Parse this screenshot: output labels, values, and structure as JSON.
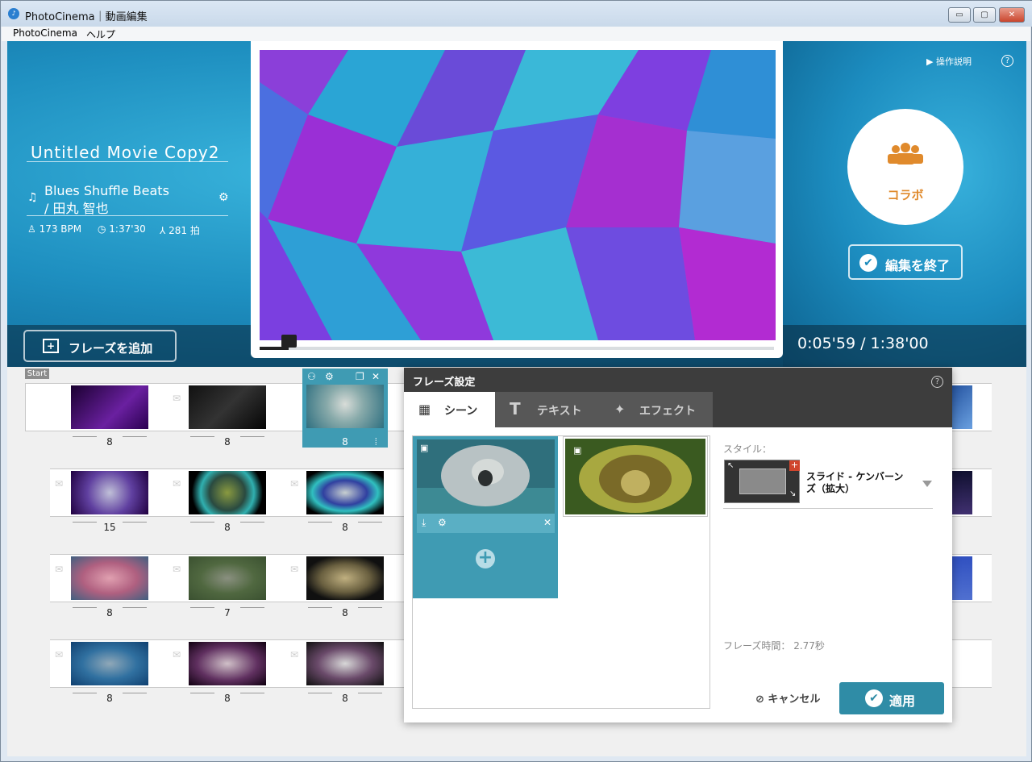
{
  "window": {
    "title": "PhotoCinema｜動画編集",
    "controls": {
      "minimize": "▭",
      "maximize": "▢",
      "close": "✕"
    }
  },
  "menu": {
    "items": [
      "PhotoCinema",
      "ヘルプ"
    ]
  },
  "project": {
    "title": "Untitled Movie Copy2",
    "song_line1": "Blues Shuffle Beats",
    "song_line2": "/ 田丸 智也",
    "bpm": "173 BPM",
    "duration": "1:37'30",
    "beats": "281 拍"
  },
  "help": {
    "tutorial_label": "操作説明",
    "help_label": "?"
  },
  "collab": {
    "label": "コラボ"
  },
  "finish_button": {
    "label": "編集を終了"
  },
  "add_phrase_button": {
    "label": "フレーズを追加"
  },
  "timecode": "0:05'59 / 1:38'00",
  "playback": {
    "progress": 0.056
  },
  "timeline": {
    "start_label": "Start",
    "rows": [
      {
        "counts": [
          "8",
          "8",
          "8"
        ]
      },
      {
        "counts": [
          "15",
          "8",
          "8"
        ]
      },
      {
        "counts": [
          "8",
          "7",
          "8"
        ]
      },
      {
        "counts": [
          "8",
          "8",
          "8"
        ]
      }
    ],
    "selected_index": "8"
  },
  "dialog": {
    "title": "フレーズ設定",
    "help": "?",
    "tabs": [
      {
        "label": "シーン",
        "icon": "film-icon",
        "active": true
      },
      {
        "label": "テキスト",
        "icon": "text-icon",
        "active": false
      },
      {
        "label": "エフェクト",
        "icon": "magic-wand-icon",
        "active": false
      }
    ],
    "add_scene": "+",
    "style_label": "スタイル：",
    "style_name_line1": "スライド - ケンバーン",
    "style_name_line2": "ズ（拡大）",
    "duration_label": "フレーズ時間： 2.77秒",
    "cancel_label": "キャンセル",
    "apply_label": "適用"
  },
  "colors": {
    "accent": "#2f8ca6",
    "collab": "#e08a2c",
    "selected": "#3f9bb3"
  }
}
